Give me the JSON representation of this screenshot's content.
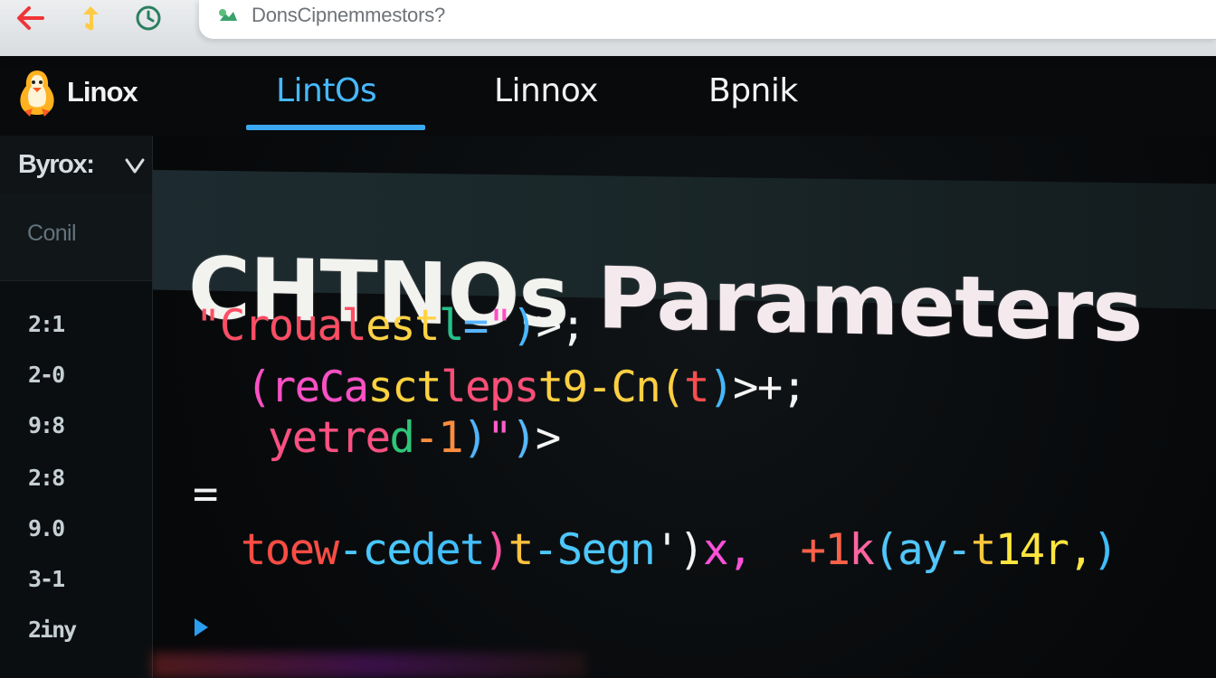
{
  "browser": {
    "address_text": "DonsCipnemmestors?"
  },
  "header": {
    "brand": "Linox",
    "tabs": [
      {
        "label": "LintOs",
        "active": true
      },
      {
        "label": "Linnox",
        "active": false
      },
      {
        "label": "Bpnik",
        "active": false
      }
    ]
  },
  "sidebar": {
    "select_label": "Byrox:",
    "cont_label": "Conil",
    "line_numbers": [
      "2:1",
      "2-0",
      "9:8",
      "2:8",
      "9.0",
      "3-1",
      "2iny"
    ]
  },
  "main": {
    "title_part_1": "CHTNOs",
    "title_part_2": "Parameters",
    "code_lines": [
      {
        "indent": 0,
        "tokens": [
          {
            "text": "\"Croual",
            "color": "#ff4d63"
          },
          {
            "text": "est",
            "color": "#ffd343"
          },
          {
            "text": "l",
            "color": "#23c38b"
          },
          {
            "text": "=",
            "color": "#58b4ff"
          },
          {
            "text": "\"",
            "color": "#ff4dc2"
          },
          {
            "text": ")",
            "color": "#48b8ff"
          },
          {
            "text": ">;",
            "color": "#f3f5f5"
          }
        ]
      },
      {
        "indent": 1,
        "tokens": [
          {
            "text": "(reCa",
            "color": "#ff4fc6"
          },
          {
            "text": "sct",
            "color": "#ffd23c"
          },
          {
            "text": "leps",
            "color": "#ff4d78"
          },
          {
            "text": "t9-Cn(",
            "color": "#ffcf40"
          },
          {
            "text": "t",
            "color": "#ff4c4c"
          },
          {
            "text": ")",
            "color": "#43b8ff"
          },
          {
            "text": ">+;",
            "color": "#f5f5f5"
          }
        ]
      },
      {
        "indent": 2,
        "tokens": [
          {
            "text": "yetre",
            "color": "#ff4f82"
          },
          {
            "text": "d",
            "color": "#2dc677"
          },
          {
            "text": "-1",
            "color": "#ff8d3d"
          },
          {
            "text": ")",
            "color": "#4eb4ff"
          },
          {
            "text": "\"",
            "color": "#ff5ccc"
          },
          {
            "text": ")",
            "color": "#57b8ff"
          },
          {
            "text": ">",
            "color": "#f6f6f6"
          }
        ]
      },
      {
        "indent": 0,
        "tokens": [
          {
            "text": "=",
            "color": "#f0f2f2"
          }
        ]
      },
      {
        "indent": 1,
        "tokens": [
          {
            "text": "toew",
            "color": "#ff4c43"
          },
          {
            "text": "-ce",
            "color": "#47c8ff"
          },
          {
            "text": "det",
            "color": "#3fbfff"
          },
          {
            "text": ")",
            "color": "#ff4fa1"
          },
          {
            "text": "t",
            "color": "#ffc33d"
          },
          {
            "text": "-Segn",
            "color": "#4bc8ff"
          },
          {
            "text": "')",
            "color": "#f5f5f5"
          },
          {
            "text": "x,",
            "color": "#ff4fdb"
          },
          {
            "text": "  +1",
            "color": "#ff6048"
          },
          {
            "text": "k",
            "color": "#ff64a1"
          },
          {
            "text": "(ay-",
            "color": "#50c7ff"
          },
          {
            "text": "t",
            "color": "#ffc63b"
          },
          {
            "text": "14r,",
            "color": "#ffe63d"
          },
          {
            "text": ")",
            "color": "#3ebeff"
          }
        ]
      }
    ]
  },
  "colors": {
    "accent": "#3ba8ef",
    "background": "#07090b",
    "title_band": "#1b2a2d"
  },
  "icons": {
    "back": "back-arrow-icon",
    "forward": "forward-icon",
    "reload": "reload-icon",
    "site": "secure-site-icon",
    "logo": "linux-penguin-logo-icon",
    "chevron": "chevron-down-icon",
    "marker": "play-marker-icon"
  }
}
